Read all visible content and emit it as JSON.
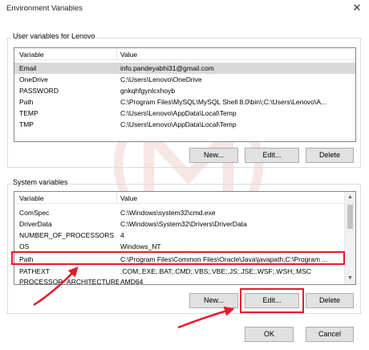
{
  "window": {
    "title": "Environment Variables",
    "close_glyph": "✕"
  },
  "user": {
    "group_label": "User variables for Lenovo",
    "columns": [
      "Variable",
      "Value"
    ],
    "rows": [
      {
        "variable": "Email",
        "value": "info.pandeyabhi31@gmail.com",
        "selected": true
      },
      {
        "variable": "OneDrive",
        "value": "C:\\Users\\Lenovo\\OneDrive"
      },
      {
        "variable": "PASSWORD",
        "value": "gnkqhfgynlcxhoyb"
      },
      {
        "variable": "Path",
        "value": "C:\\Program Files\\MySQL\\MySQL Shell 8.0\\bin\\;C:\\Users\\Lenovo\\A..."
      },
      {
        "variable": "TEMP",
        "value": "C:\\Users\\Lenovo\\AppData\\Local\\Temp"
      },
      {
        "variable": "TMP",
        "value": "C:\\Users\\Lenovo\\AppData\\Local\\Temp"
      }
    ],
    "buttons": {
      "new": "New...",
      "edit": "Edit...",
      "delete": "Delete"
    }
  },
  "system": {
    "group_label": "System variables",
    "columns": [
      "Variable",
      "Value"
    ],
    "rows": [
      {
        "variable": "ComSpec",
        "value": "C:\\Windows\\system32\\cmd.exe"
      },
      {
        "variable": "DriverData",
        "value": "C:\\Windows\\System32\\Drivers\\DriverData"
      },
      {
        "variable": "NUMBER_OF_PROCESSORS",
        "value": "4"
      },
      {
        "variable": "OS",
        "value": "Windows_NT"
      },
      {
        "variable": "Path",
        "value": "C:\\Program Files\\Common Files\\Oracle\\Java\\javapath;C:\\Program ...",
        "highlighted": true
      },
      {
        "variable": "PATHEXT",
        "value": ".COM;.EXE;.BAT;.CMD;.VBS;.VBE;.JS;.JSE;.WSF;.WSH;.MSC"
      },
      {
        "variable": "PROCESSOR_ARCHITECTURE",
        "value": "AMD64"
      }
    ],
    "buttons": {
      "new": "New...",
      "edit": "Edit...",
      "delete": "Delete"
    }
  },
  "footer": {
    "ok": "OK",
    "cancel": "Cancel"
  },
  "icons": {
    "scroll_up": "▲",
    "scroll_down": "▼"
  },
  "colors": {
    "annotation": "#e8192c",
    "selected_row": "#d9d9d9",
    "button_face": "#e1e1e1"
  }
}
